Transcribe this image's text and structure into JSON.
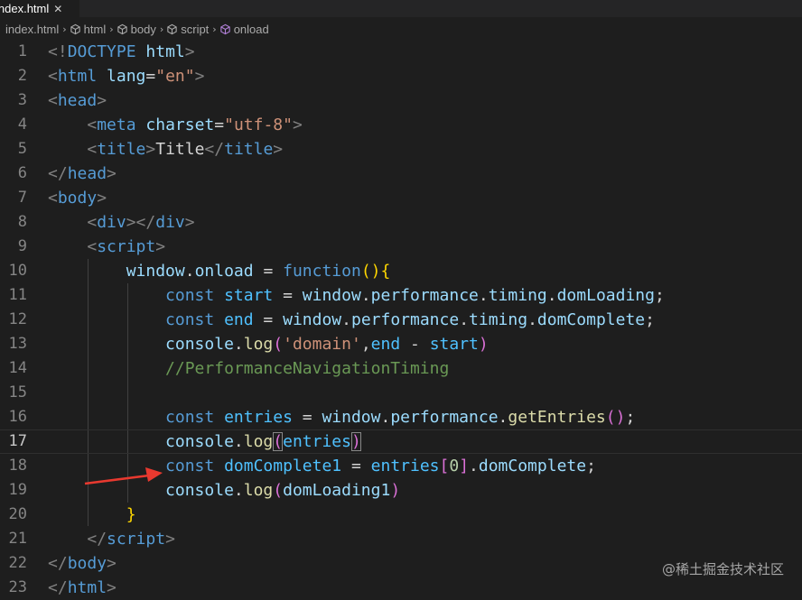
{
  "tab": {
    "filename": "index.html",
    "close_glyph": "✕"
  },
  "breadcrumb": [
    {
      "label": "index.html",
      "icon": "none"
    },
    {
      "label": "html",
      "icon": "cube-icon"
    },
    {
      "label": "body",
      "icon": "cube-icon"
    },
    {
      "label": "script",
      "icon": "cube-icon"
    },
    {
      "label": "onload",
      "icon": "method-icon"
    }
  ],
  "breadcrumb_separator": "›",
  "current_line": 17,
  "lines": [
    {
      "n": "1",
      "tokens": [
        [
          "<!",
          "t-punct"
        ],
        [
          "DOCTYPE",
          "t-tag"
        ],
        [
          " ",
          ""
        ],
        [
          "html",
          "t-attr"
        ],
        [
          ">",
          "t-punct"
        ]
      ]
    },
    {
      "n": "2",
      "tokens": [
        [
          "<",
          "t-punct"
        ],
        [
          "html",
          "t-tag"
        ],
        [
          " ",
          ""
        ],
        [
          "lang",
          "t-attr"
        ],
        [
          "=",
          ""
        ],
        [
          "\"en\"",
          "t-str"
        ],
        [
          ">",
          "t-punct"
        ]
      ]
    },
    {
      "n": "3",
      "tokens": [
        [
          "<",
          "t-punct"
        ],
        [
          "head",
          "t-tag"
        ],
        [
          ">",
          "t-punct"
        ]
      ]
    },
    {
      "n": "4",
      "tokens": [
        [
          "    ",
          ""
        ],
        [
          "<",
          "t-punct"
        ],
        [
          "meta",
          "t-tag"
        ],
        [
          " ",
          ""
        ],
        [
          "charset",
          "t-attr"
        ],
        [
          "=",
          ""
        ],
        [
          "\"utf-8\"",
          "t-str"
        ],
        [
          ">",
          "t-punct"
        ]
      ]
    },
    {
      "n": "5",
      "tokens": [
        [
          "    ",
          ""
        ],
        [
          "<",
          "t-punct"
        ],
        [
          "title",
          "t-tag"
        ],
        [
          ">",
          "t-punct"
        ],
        [
          "Title",
          "t-text"
        ],
        [
          "</",
          "t-punct"
        ],
        [
          "title",
          "t-tag"
        ],
        [
          ">",
          "t-punct"
        ]
      ]
    },
    {
      "n": "6",
      "tokens": [
        [
          "</",
          "t-punct"
        ],
        [
          "head",
          "t-tag"
        ],
        [
          ">",
          "t-punct"
        ]
      ]
    },
    {
      "n": "7",
      "tokens": [
        [
          "<",
          "t-punct"
        ],
        [
          "body",
          "t-tag"
        ],
        [
          ">",
          "t-punct"
        ]
      ]
    },
    {
      "n": "8",
      "tokens": [
        [
          "    ",
          ""
        ],
        [
          "<",
          "t-punct"
        ],
        [
          "div",
          "t-tag"
        ],
        [
          "></",
          "t-punct"
        ],
        [
          "div",
          "t-tag"
        ],
        [
          ">",
          "t-punct"
        ]
      ]
    },
    {
      "n": "9",
      "tokens": [
        [
          "    ",
          ""
        ],
        [
          "<",
          "t-punct"
        ],
        [
          "script",
          "t-tag"
        ],
        [
          ">",
          "t-punct"
        ]
      ]
    },
    {
      "n": "10",
      "tokens": [
        [
          "        ",
          ""
        ],
        [
          "window",
          "t-var"
        ],
        [
          ".",
          ""
        ],
        [
          "onload",
          "t-var"
        ],
        [
          " = ",
          ""
        ],
        [
          "function",
          "t-kw"
        ],
        [
          "()",
          "t-b1"
        ],
        [
          "{",
          "t-b1"
        ]
      ]
    },
    {
      "n": "11",
      "tokens": [
        [
          "            ",
          ""
        ],
        [
          "const",
          "t-kw"
        ],
        [
          " ",
          ""
        ],
        [
          "start",
          "t-const"
        ],
        [
          " = ",
          ""
        ],
        [
          "window",
          "t-var"
        ],
        [
          ".",
          ""
        ],
        [
          "performance",
          "t-var"
        ],
        [
          ".",
          ""
        ],
        [
          "timing",
          "t-var"
        ],
        [
          ".",
          ""
        ],
        [
          "domLoading",
          "t-var"
        ],
        [
          ";",
          ""
        ]
      ]
    },
    {
      "n": "12",
      "tokens": [
        [
          "            ",
          ""
        ],
        [
          "const",
          "t-kw"
        ],
        [
          " ",
          ""
        ],
        [
          "end",
          "t-const"
        ],
        [
          " = ",
          ""
        ],
        [
          "window",
          "t-var"
        ],
        [
          ".",
          ""
        ],
        [
          "performance",
          "t-var"
        ],
        [
          ".",
          ""
        ],
        [
          "timing",
          "t-var"
        ],
        [
          ".",
          ""
        ],
        [
          "domComplete",
          "t-var"
        ],
        [
          ";",
          ""
        ]
      ]
    },
    {
      "n": "13",
      "tokens": [
        [
          "            ",
          ""
        ],
        [
          "console",
          "t-var"
        ],
        [
          ".",
          ""
        ],
        [
          "log",
          "t-fn"
        ],
        [
          "(",
          "t-b2"
        ],
        [
          "'domain'",
          "t-str"
        ],
        [
          ",",
          ""
        ],
        [
          "end",
          "t-const"
        ],
        [
          " - ",
          ""
        ],
        [
          "start",
          "t-const"
        ],
        [
          ")",
          "t-b2"
        ]
      ]
    },
    {
      "n": "14",
      "tokens": [
        [
          "            ",
          ""
        ],
        [
          "//PerformanceNavigationTiming",
          "t-cmt"
        ]
      ]
    },
    {
      "n": "15",
      "tokens": []
    },
    {
      "n": "16",
      "tokens": [
        [
          "            ",
          ""
        ],
        [
          "const",
          "t-kw"
        ],
        [
          " ",
          ""
        ],
        [
          "entries",
          "t-const"
        ],
        [
          " = ",
          ""
        ],
        [
          "window",
          "t-var"
        ],
        [
          ".",
          ""
        ],
        [
          "performance",
          "t-var"
        ],
        [
          ".",
          ""
        ],
        [
          "getEntries",
          "t-fn"
        ],
        [
          "()",
          "t-b2"
        ],
        [
          ";",
          ""
        ]
      ]
    },
    {
      "n": "17",
      "tokens": [
        [
          "            ",
          ""
        ],
        [
          "console",
          "t-var"
        ],
        [
          ".",
          ""
        ],
        [
          "log",
          "t-fn"
        ],
        [
          "(",
          "t-b2 t-boxed"
        ],
        [
          "entries",
          "t-const"
        ],
        [
          ")",
          "t-b2 t-boxed"
        ]
      ]
    },
    {
      "n": "18",
      "tokens": [
        [
          "            ",
          ""
        ],
        [
          "const",
          "t-kw"
        ],
        [
          " ",
          ""
        ],
        [
          "domComplete1",
          "t-const"
        ],
        [
          " = ",
          ""
        ],
        [
          "entries",
          "t-const"
        ],
        [
          "[",
          "t-b2"
        ],
        [
          "0",
          "t-num"
        ],
        [
          "]",
          "t-b2"
        ],
        [
          ".",
          ""
        ],
        [
          "domComplete",
          "t-var"
        ],
        [
          ";",
          ""
        ]
      ]
    },
    {
      "n": "19",
      "tokens": [
        [
          "            ",
          ""
        ],
        [
          "console",
          "t-var"
        ],
        [
          ".",
          ""
        ],
        [
          "log",
          "t-fn"
        ],
        [
          "(",
          "t-b2"
        ],
        [
          "domLoading1",
          "t-var"
        ],
        [
          ")",
          "t-b2"
        ]
      ]
    },
    {
      "n": "20",
      "tokens": [
        [
          "        ",
          ""
        ],
        [
          "}",
          "t-b1"
        ]
      ]
    },
    {
      "n": "21",
      "tokens": [
        [
          "    ",
          ""
        ],
        [
          "</",
          "t-punct"
        ],
        [
          "script",
          "t-tag"
        ],
        [
          ">",
          "t-punct"
        ]
      ]
    },
    {
      "n": "22",
      "tokens": [
        [
          "</",
          "t-punct"
        ],
        [
          "body",
          "t-tag"
        ],
        [
          ">",
          "t-punct"
        ]
      ]
    },
    {
      "n": "23",
      "tokens": [
        [
          "</",
          "t-punct"
        ],
        [
          "html",
          "t-tag"
        ],
        [
          ">",
          "t-punct"
        ]
      ]
    }
  ],
  "watermark": "@稀土掘金技术社区",
  "colors": {
    "background": "#1e1e1e",
    "annotation_arrow": "#e8392f"
  }
}
